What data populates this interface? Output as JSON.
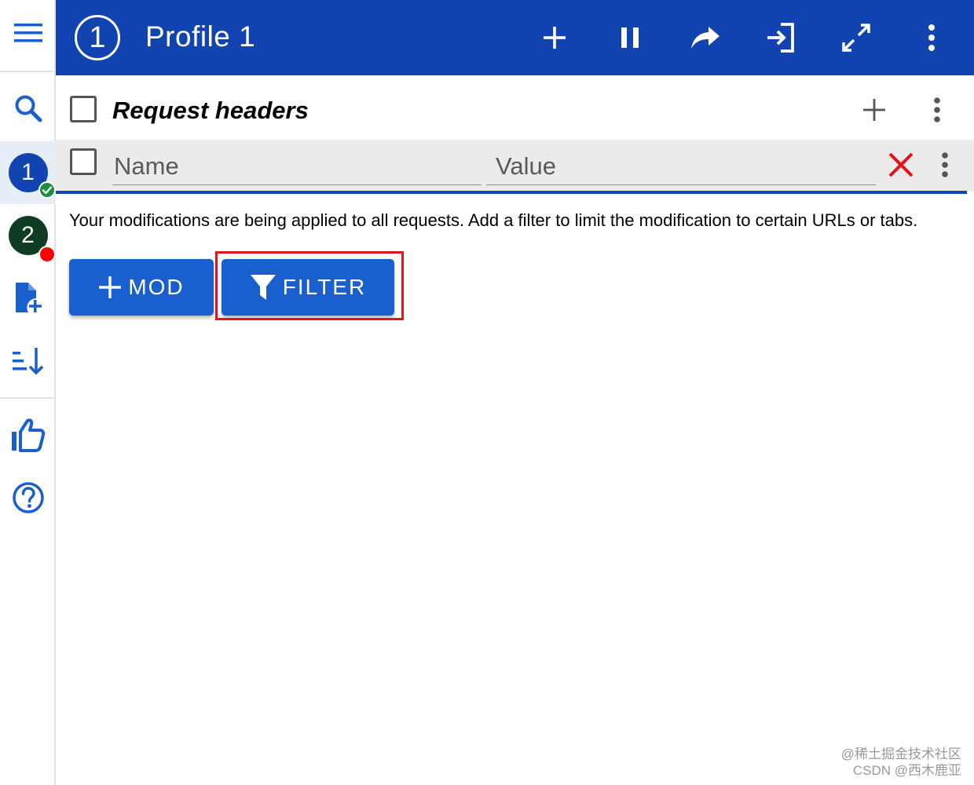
{
  "sidebar": {
    "menu_icon": "hamburger-menu-icon",
    "search_icon": "search-icon",
    "profiles": [
      {
        "label": "1",
        "color": "#1144b0",
        "status": "active",
        "status_color": "#1e8e3e"
      },
      {
        "label": "2",
        "color": "#0e3d24",
        "status": "error",
        "status_color": "#ff0000"
      }
    ],
    "add_profile_icon": "file-add-icon",
    "sort_icon": "sort-descending-icon",
    "like_icon": "thumbs-up-icon",
    "help_icon": "help-circle-icon"
  },
  "header": {
    "profile_number": "1",
    "title": "Profile 1",
    "bg_color": "#1144b0",
    "actions": [
      "add-icon",
      "pause-icon",
      "share-icon",
      "import-icon",
      "expand-icon",
      "more-vertical-icon"
    ]
  },
  "section": {
    "title": "Request headers",
    "add_icon": "add-icon",
    "more_icon": "more-vertical-icon"
  },
  "header_row": {
    "name_placeholder": "Name",
    "value_placeholder": "Value",
    "delete_icon": "close-icon",
    "delete_color": "#e3131b",
    "more_icon": "more-vertical-icon"
  },
  "notice": "Your modifications are being applied to all requests. Add a filter to limit the modification to certain URLs or tabs.",
  "buttons": {
    "mod_label": "MOD",
    "filter_label": "FILTER",
    "color": "#1a5fce",
    "highlight_color": "#e3131b"
  },
  "watermark": {
    "line1": "@稀土掘金技术社区",
    "line2": "CSDN @西木鹿亚"
  }
}
